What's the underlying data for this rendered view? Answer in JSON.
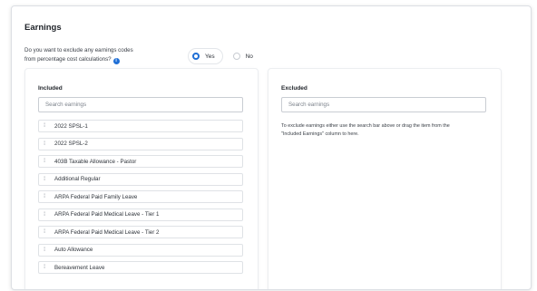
{
  "section": {
    "title": "Earnings",
    "question_line1": "Do you want to exclude any earnings codes",
    "question_line2": "from percentage cost calculations?",
    "info_icon": "info-icon",
    "options": [
      {
        "label": "Yes",
        "selected": true
      },
      {
        "label": "No",
        "selected": false
      }
    ]
  },
  "included": {
    "title": "Included",
    "search_placeholder": "Search earnings",
    "items": [
      "2022 SPSL-1",
      "2022 SPSL-2",
      "403B Taxable Allowance - Pastor",
      "Additional Regular",
      "ARPA Federal Paid Family Leave",
      "ARPA Federal Paid Medical Leave - Tier 1",
      "ARPA Federal Paid Medical Leave - Tier 2",
      "Auto Allowance",
      "Bereavement Leave"
    ]
  },
  "excluded": {
    "title": "Excluded",
    "search_placeholder": "Search earnings",
    "hint_line1": "To exclude earnings either use the search bar above or drag the item from the",
    "hint_line2": "\"Included Earnings\" column to here."
  },
  "colors": {
    "accent": "#1f6fd6",
    "border": "#dcdfe4"
  }
}
